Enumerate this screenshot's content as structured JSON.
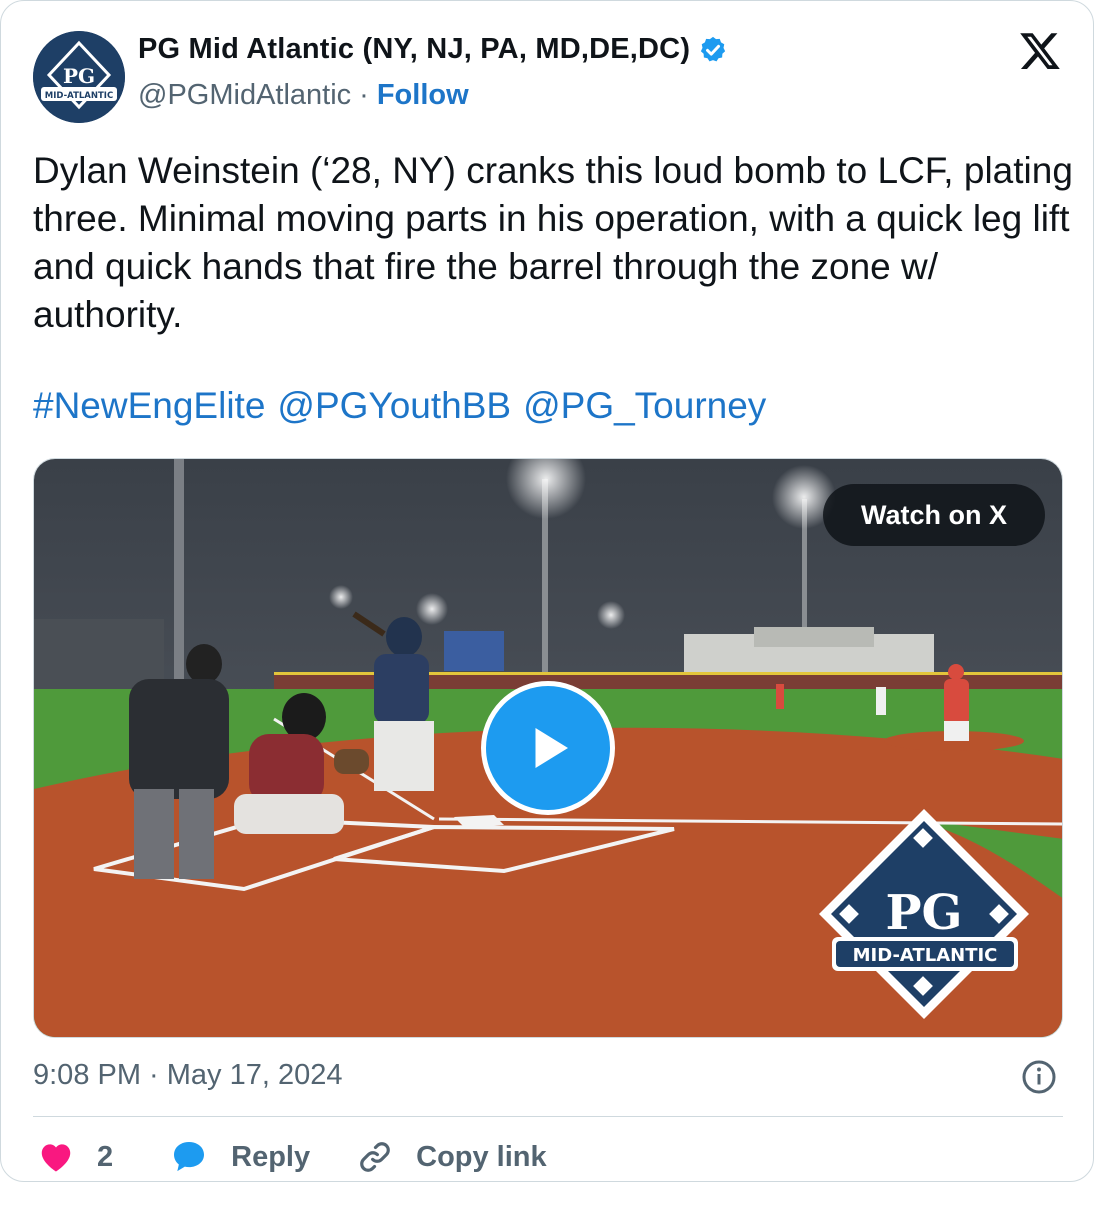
{
  "author": {
    "name": "PG Mid Atlantic (NY, NJ, PA, MD,DE,DC)",
    "handle": "@PGMidAtlantic",
    "separator": "·",
    "follow_label": "Follow",
    "verified": true,
    "avatar_text": "MID-ATLANTIC",
    "avatar_logo": "PG"
  },
  "tweet": {
    "text": "Dylan Weinstein (‘28, NY) cranks this loud bomb to LCF, plating three. Minimal moving parts in his operation, with a quick leg lift and quick hands that fire the barrel through the zone w/ authority.",
    "tags": [
      "#NewEngElite",
      "@PGYouthBB",
      "@PG_Tourney"
    ]
  },
  "media": {
    "watch_label": "Watch on X",
    "watermark_logo": "PG",
    "watermark_text": "MID-ATLANTIC"
  },
  "meta": {
    "timestamp": "9:08 PM · May 17, 2024"
  },
  "actions": {
    "like_count": "2",
    "reply_label": "Reply",
    "copy_label": "Copy link"
  },
  "colors": {
    "link": "#1d75c8",
    "verified": "#1d9bf0",
    "like": "#f91880",
    "reply": "#1d9bf0",
    "brand_navy": "#1e3f66"
  },
  "icons": [
    "x-logo-icon",
    "verified-badge-icon",
    "play-icon",
    "info-icon",
    "heart-icon",
    "reply-bubble-icon",
    "link-icon"
  ]
}
